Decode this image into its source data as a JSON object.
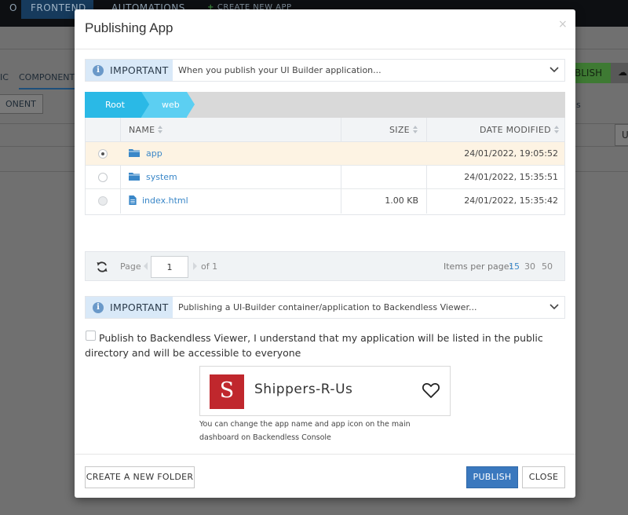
{
  "background": {
    "tabs": [
      "O",
      "FRONTEND",
      "AUTOMATIONS"
    ],
    "create_new_app": "CREATE NEW APP",
    "subtabs": [
      "IC",
      "COMPONENTS"
    ],
    "component_button": "ONENT",
    "publish_partial": "BLISH",
    "side_letter_s": "s",
    "side_letter_u": "U"
  },
  "modal": {
    "title": "Publishing App",
    "close_icon": "×",
    "important_1": {
      "label": "IMPORTANT",
      "text": "When you publish your UI Builder application..."
    },
    "breadcrumb": [
      "Root",
      "web"
    ],
    "table": {
      "headers": {
        "name": "NAME",
        "size": "SIZE",
        "date": "DATE MODIFIED"
      },
      "rows": [
        {
          "type": "folder",
          "name": "app",
          "size": "",
          "date": "24/01/2022, 19:05:52",
          "selected": true
        },
        {
          "type": "folder",
          "name": "system",
          "size": "",
          "date": "24/01/2022, 15:35:51",
          "selected": false
        },
        {
          "type": "file",
          "name": "index.html",
          "size": "1.00 KB",
          "date": "24/01/2022, 15:35:42",
          "selected": false
        }
      ]
    },
    "pager": {
      "page_label": "Page",
      "page_value": "1",
      "of_label": "of 1",
      "items_per_page_label": "Items per page:",
      "options": [
        "15",
        "30",
        "50"
      ],
      "active_option": "15"
    },
    "important_2": {
      "label": "IMPORTANT",
      "text": "Publishing a UI-Builder container/application to Backendless Viewer..."
    },
    "publish_checkbox_text": "Publish to Backendless Viewer, I understand that my application will be listed in the public directory and will be accessible to everyone",
    "app_card": {
      "icon_letter": "S",
      "name": "Shippers-R-Us",
      "note": "You can change the app name and app icon on the main dashboard on Backendless Console"
    },
    "buttons": {
      "create_folder": "CREATE A NEW FOLDER",
      "publish": "PUBLISH",
      "close": "CLOSE"
    }
  },
  "colors": {
    "accent": "#3a78be",
    "breadcrumb_root": "#2ab9e6",
    "breadcrumb_web": "#5ccff2",
    "app_icon": "#c0272d",
    "selected_row": "#fdf3e3"
  }
}
